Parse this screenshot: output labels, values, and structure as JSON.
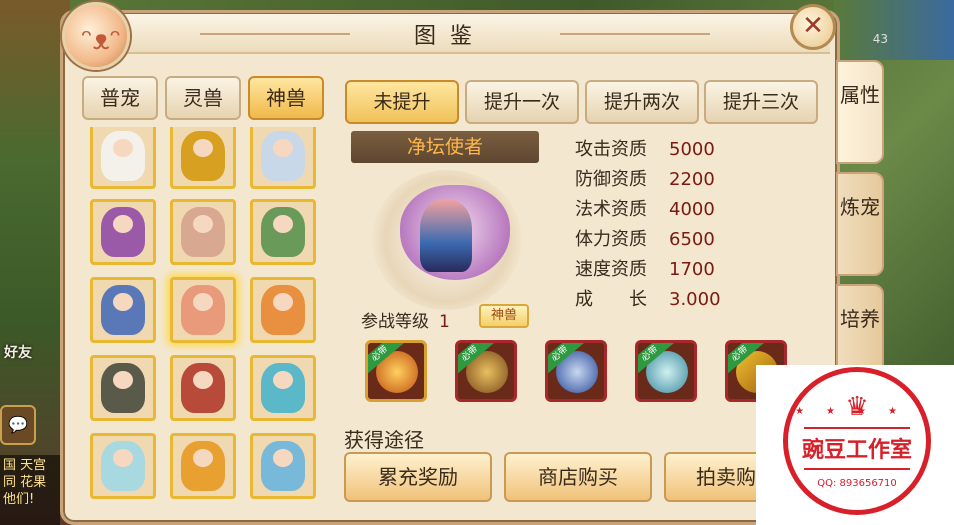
{
  "background": {
    "friend_label": "好友",
    "level_label": "43",
    "chat_lines": [
      "国 天宫",
      "同 花果",
      "他们!"
    ]
  },
  "header": {
    "title": "图鉴",
    "close_symbol": "✕"
  },
  "category_tabs": [
    {
      "label": "普宠",
      "active": false
    },
    {
      "label": "灵兽",
      "active": false
    },
    {
      "label": "神兽",
      "active": true
    }
  ],
  "level_tabs": [
    {
      "label": "未提升",
      "active": true
    },
    {
      "label": "提升一次",
      "active": false
    },
    {
      "label": "提升两次",
      "active": false
    },
    {
      "label": "提升三次",
      "active": false
    }
  ],
  "pet": {
    "name": "净坛使者",
    "battle_level_label": "参战等级",
    "battle_level": "1",
    "rank_badge": "神兽"
  },
  "stats": [
    {
      "label": "攻击资质",
      "value": "5000"
    },
    {
      "label": "防御资质",
      "value": "2200"
    },
    {
      "label": "法术资质",
      "value": "4000"
    },
    {
      "label": "体力资质",
      "value": "6500"
    },
    {
      "label": "速度资质",
      "value": "1700"
    },
    {
      "label": "成　　长",
      "value": "3.000"
    }
  ],
  "skills": [
    {
      "ribbon": "必带",
      "icon": "fire-orb-icon"
    },
    {
      "ribbon": "必带",
      "icon": "beast-head-icon"
    },
    {
      "ribbon": "必带",
      "icon": "warrior-strike-icon"
    },
    {
      "ribbon": "必带",
      "icon": "sword-icon"
    },
    {
      "ribbon": "必带",
      "icon": "scroll-icon"
    }
  ],
  "obtain": {
    "label": "获得途径",
    "buttons": [
      "累充奖励",
      "商店购买",
      "拍卖购"
    ]
  },
  "side_tabs": [
    {
      "label": "属性",
      "active": true
    },
    {
      "label": "炼宠",
      "active": false
    },
    {
      "label": "培养",
      "active": false
    }
  ],
  "grid_pets": [
    {
      "icon": "cow-pet-icon",
      "color": "#f4f0ea",
      "selected": false
    },
    {
      "icon": "golden-wheel-pet-icon",
      "color": "#d8a020",
      "selected": false
    },
    {
      "icon": "silver-warrior-pet-icon",
      "color": "#c8d8e8",
      "selected": false
    },
    {
      "icon": "purple-demon-pet-icon",
      "color": "#9a5aa8",
      "selected": false
    },
    {
      "icon": "maiden-pet-icon",
      "color": "#d8a890",
      "selected": false
    },
    {
      "icon": "green-archer-pet-icon",
      "color": "#6a9a5a",
      "selected": false
    },
    {
      "icon": "blue-warrior-pet-icon",
      "color": "#5a78b8",
      "selected": false
    },
    {
      "icon": "pig-pet-icon",
      "color": "#e89a7a",
      "selected": true
    },
    {
      "icon": "fire-rooster-pet-icon",
      "color": "#e89040",
      "selected": false
    },
    {
      "icon": "dark-monk-pet-icon",
      "color": "#5a5a4a",
      "selected": false
    },
    {
      "icon": "red-swordsman-pet-icon",
      "color": "#b84a3a",
      "selected": false
    },
    {
      "icon": "cyan-mage-pet-icon",
      "color": "#5ab8c8",
      "selected": false
    },
    {
      "icon": "white-fairy-pet-icon",
      "color": "#a8d8e0",
      "selected": false
    },
    {
      "icon": "monkey-king-pet-icon",
      "color": "#e8a030",
      "selected": false
    },
    {
      "icon": "sky-warrior-pet-icon",
      "color": "#78b8d8",
      "selected": false
    }
  ],
  "watermark": {
    "crown": "♛",
    "stars": "★★★★",
    "text": "豌豆工作室",
    "qq": "QQ: 893656710"
  }
}
